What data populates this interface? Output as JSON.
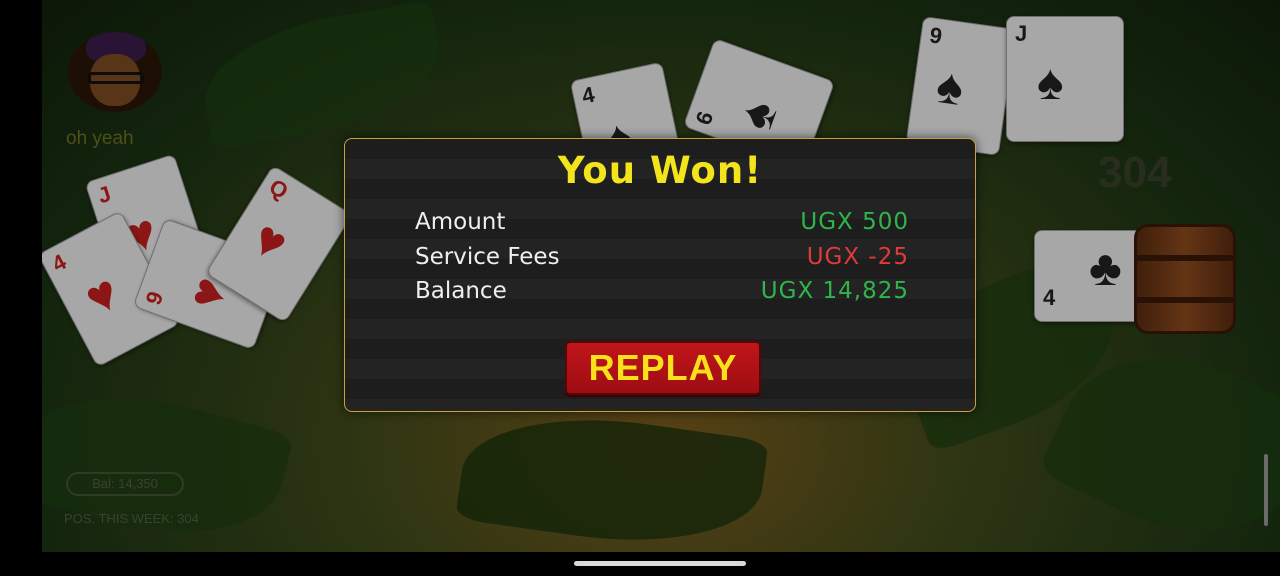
{
  "player": {
    "chat_message": "oh yeah",
    "balance_label": "Bal: 14,350",
    "position_label": "POS. THIS WEEK: 304"
  },
  "table": {
    "score": "304",
    "cards_left": [
      {
        "rank": "J",
        "suit": "♥"
      },
      {
        "rank": "Q",
        "suit": "♥"
      },
      {
        "rank": "9",
        "suit": "♥"
      },
      {
        "rank": "4",
        "suit": "♥"
      }
    ],
    "cards_top": [
      {
        "rank": "4",
        "suit": "♠"
      },
      {
        "rank": "6",
        "suit": "♠"
      },
      {
        "rank": "9",
        "suit": "♠"
      },
      {
        "rank": "J",
        "suit": "♠"
      }
    ],
    "card_right": {
      "rank": "4",
      "suit": "♣"
    }
  },
  "dialog": {
    "title": "You Won!",
    "rows": [
      {
        "label": "Amount",
        "value": "UGX 500",
        "color": "#2fb54b"
      },
      {
        "label": "Service Fees",
        "value": "UGX -25",
        "color": "#e03a3a"
      },
      {
        "label": "Balance",
        "value": "UGX 14,825",
        "color": "#2fb54b"
      }
    ],
    "replay_label": "REPLAY"
  },
  "colors": {
    "title": "#f4e41c",
    "border": "#c9a23a",
    "replay_bg": "#c0151a"
  }
}
